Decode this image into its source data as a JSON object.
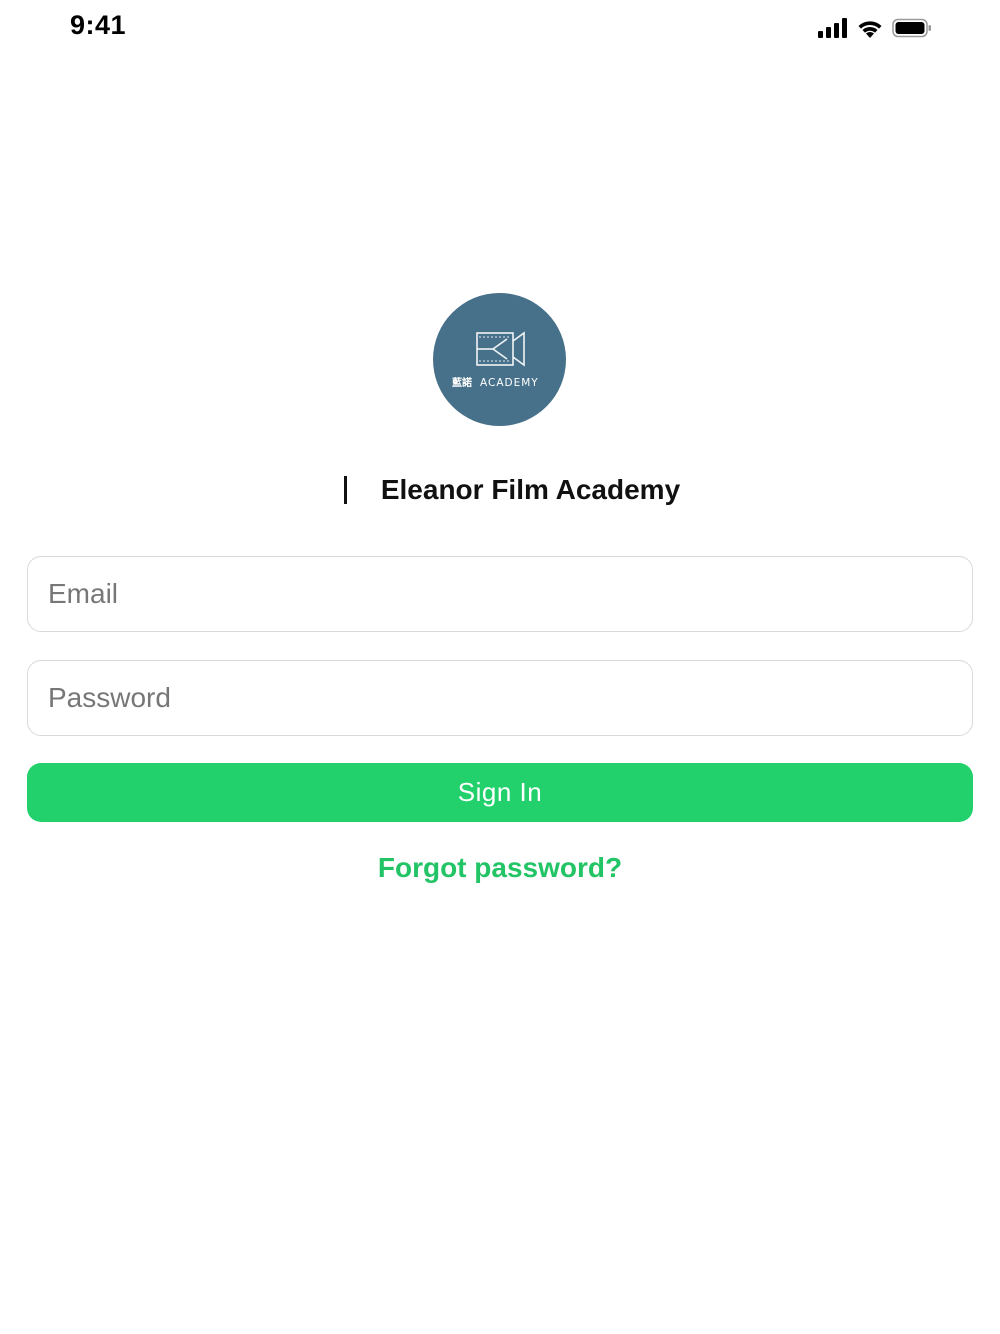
{
  "status_bar": {
    "time": "9:41",
    "icons": [
      "cellular-signal-icon",
      "wifi-icon",
      "battery-icon"
    ]
  },
  "logo": {
    "text_cjk": "藍諾",
    "text": "ACADEMY",
    "background_color": "#47718a"
  },
  "app_name": "Eleanor Film Academy",
  "form": {
    "email_placeholder": "Email",
    "password_placeholder": "Password",
    "signin_label": "Sign In",
    "forgot_label": "Forgot password?"
  },
  "colors": {
    "accent": "#22d16c",
    "link": "#22c466",
    "field_border": "#d9d9d9"
  }
}
